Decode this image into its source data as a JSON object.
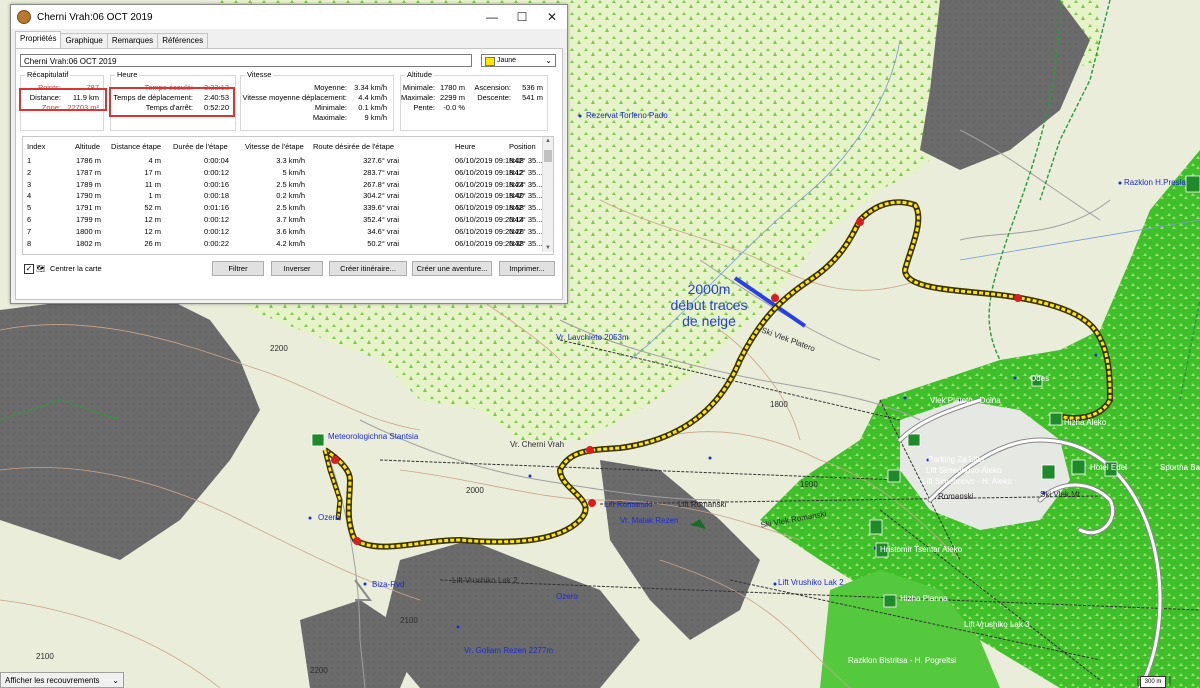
{
  "window": {
    "title": "Cherni Vrah:06 OCT 2019",
    "controls": {
      "minimize": "—",
      "maximize": "☐",
      "close": "✕"
    },
    "tabs": [
      "Propriétés",
      "Graphique",
      "Remarques",
      "Références"
    ],
    "name_value": "Cherni Vrah:06 OCT 2019",
    "color_label": "Jaune",
    "color_hex": "#ffe800"
  },
  "summary": {
    "recap": {
      "title": "Récapitulatif",
      "points_label": "Points:",
      "points_value": "787",
      "distance_label": "Distance:",
      "distance_value": "11.9 km",
      "zone_label": "Zone:",
      "zone_value": "22703 m²"
    },
    "heure": {
      "title": "Heure",
      "elapsed_label": "Temps écoulé:",
      "elapsed_value": "3:33:13",
      "moving_label": "Temps de déplacement:",
      "moving_value": "2:40:53",
      "stop_label": "Temps d'arrêt:",
      "stop_value": "0:52:20"
    },
    "vitesse": {
      "title": "Vitesse",
      "avg_label": "Moyenne:",
      "avg_value": "3.34 km/h",
      "avgmove_label": "Vitesse moyenne déplacement:",
      "avgmove_value": "4.4 km/h",
      "min_label": "Minimale:",
      "min_value": "0.1 km/h",
      "max_label": "Maximale:",
      "max_value": "9 km/h"
    },
    "altitude": {
      "title": "Altitude",
      "min_label": "Minimale:",
      "min_value": "1780 m",
      "max_label": "Maximale:",
      "max_value": "2299 m",
      "slope_label": "Pente:",
      "slope_value": "-0.0 %",
      "asc_label": "Ascension:",
      "asc_value": "536 m",
      "desc_label": "Descente:",
      "desc_value": "541 m"
    }
  },
  "table": {
    "headers": [
      "Index",
      "Altitude",
      "Distance étape",
      "Durée de l'étape",
      "Vitesse de l'étape",
      "Route désirée de l'étape",
      "Heure",
      "Position"
    ],
    "rows": [
      [
        "1",
        "1786 m",
        "4 m",
        "0:00:04",
        "3.3 km/h",
        "327.6° vrai",
        "06/10/2019 09:18:08",
        "N42° 35..."
      ],
      [
        "2",
        "1787 m",
        "17 m",
        "0:00:12",
        "5 km/h",
        "283.7° vrai",
        "06/10/2019 09:18:12",
        "N42° 35..."
      ],
      [
        "3",
        "1789 m",
        "11 m",
        "0:00:16",
        "2.5 km/h",
        "267.8° vrai",
        "06/10/2019 09:18:24",
        "N42° 35..."
      ],
      [
        "4",
        "1790 m",
        "1 m",
        "0:00:18",
        "0.2 km/h",
        "304.2° vrai",
        "06/10/2019 09:18:40",
        "N42° 35..."
      ],
      [
        "5",
        "1791 m",
        "52 m",
        "0:01:16",
        "2.5 km/h",
        "339.6° vrai",
        "06/10/2019 09:18:58",
        "N42° 35..."
      ],
      [
        "6",
        "1799 m",
        "12 m",
        "0:00:12",
        "3.7 km/h",
        "352.4° vrai",
        "06/10/2019 09:20:14",
        "N42° 35..."
      ],
      [
        "7",
        "1800 m",
        "12 m",
        "0:00:12",
        "3.6 km/h",
        "34.6° vrai",
        "06/10/2019 09:20:26",
        "N42° 35..."
      ],
      [
        "8",
        "1802 m",
        "26 m",
        "0:00:22",
        "4.2 km/h",
        "50.2° vrai",
        "06/10/2019 09:20:38",
        "N42° 35..."
      ]
    ]
  },
  "controls": {
    "center_map_label": "Centrer la carte",
    "filter": "Filtrer",
    "invert": "Inverser",
    "create_route": "Créer itinéraire...",
    "create_adventure": "Créer une aventure...",
    "print": "Imprimer..."
  },
  "map": {
    "annotation": [
      "2000m",
      "début traces",
      "de neige"
    ],
    "labels": {
      "rezervat": "Rezervat Torfeno Pado",
      "lavchieto": "Vr. Lavchieto 2053m",
      "meteo": "Meteorologichna Stantsia",
      "cherni_vrah": "Vr. Cherni Vrah",
      "ski_vlek_platero": "Ski Vlek Platero",
      "ski_vlek_mt": "Ski Vlek Mt",
      "ski_vlek_romanski": "Ski Vlek Romanski",
      "lift_romanski": "Lift Romanski",
      "lift_romanski2": "Lift Romanski",
      "vr_malak_rezen": "Vr. Malak Rezen",
      "biza": "Biza-Rvd",
      "lift_vrushiko": "Lift Vrushiko Lak 2",
      "lift_vrushiko2": "Lift Vrushiko Lak 2",
      "vr_goliam": "Vr. Goliam Rezen 2277m",
      "ozero": "Ozero",
      "parking": "Parking Za Lifta",
      "simeonovo": "Lift Simeonovo-Aleko",
      "simeonovo2": "Lift Simeonovo - H. Aleko",
      "romanski_dark": "Romanski",
      "hizha_aleko": "Hizha Aleko",
      "hotel_edel": "Hotel Edel",
      "sportna": "Sportna Baza",
      "razklon_preslap": "Razklon H.Presla",
      "ski_vlek_plato": "Vlek Plateto - Dolna",
      "hristomir": "Hristomir Tsentar Aleko",
      "planna": "Hizha Planna",
      "razklon_bistritsa": "Razklon Bistritsa - H. Pogreltsi",
      "lift_vrushiko_lak": "Lift Vrushiko Lak 3",
      "odes": "Odes"
    },
    "contours": [
      "2200",
      "2100",
      "2000",
      "1900",
      "1800",
      "2200",
      "2100"
    ],
    "route_color": "#ffe800",
    "route_outline": "#3a3000"
  },
  "statusbar": {
    "overlay_dropdown": "Afficher les recouvrements",
    "scale": "300 m"
  }
}
